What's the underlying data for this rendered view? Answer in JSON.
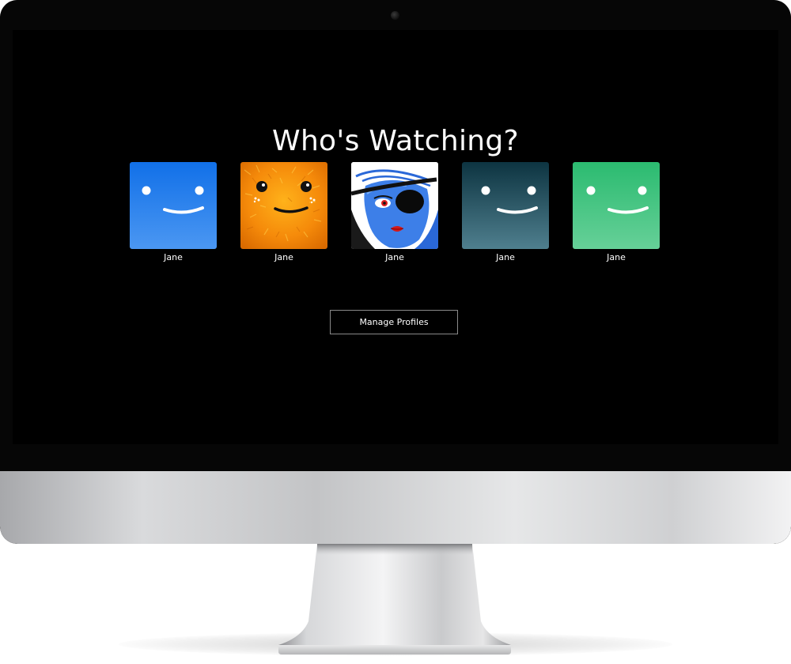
{
  "screen": {
    "title": "Who's Watching?",
    "profiles": [
      {
        "name": "Jane",
        "avatar": "smiley-blue",
        "color": "#2a7ef0"
      },
      {
        "name": "Jane",
        "avatar": "smiley-orange-fuzzy",
        "color": "#f59a10"
      },
      {
        "name": "Jane",
        "avatar": "pirate-woman",
        "color": "#2f6fe0"
      },
      {
        "name": "Jane",
        "avatar": "smiley-dark-teal",
        "color": "#1f4a58"
      },
      {
        "name": "Jane",
        "avatar": "smiley-green",
        "color": "#3cc27e"
      }
    ],
    "manage_label": "Manage Profiles"
  },
  "colors": {
    "background": "#000000",
    "text": "#ffffff",
    "button_border": "#8a8a8a"
  }
}
